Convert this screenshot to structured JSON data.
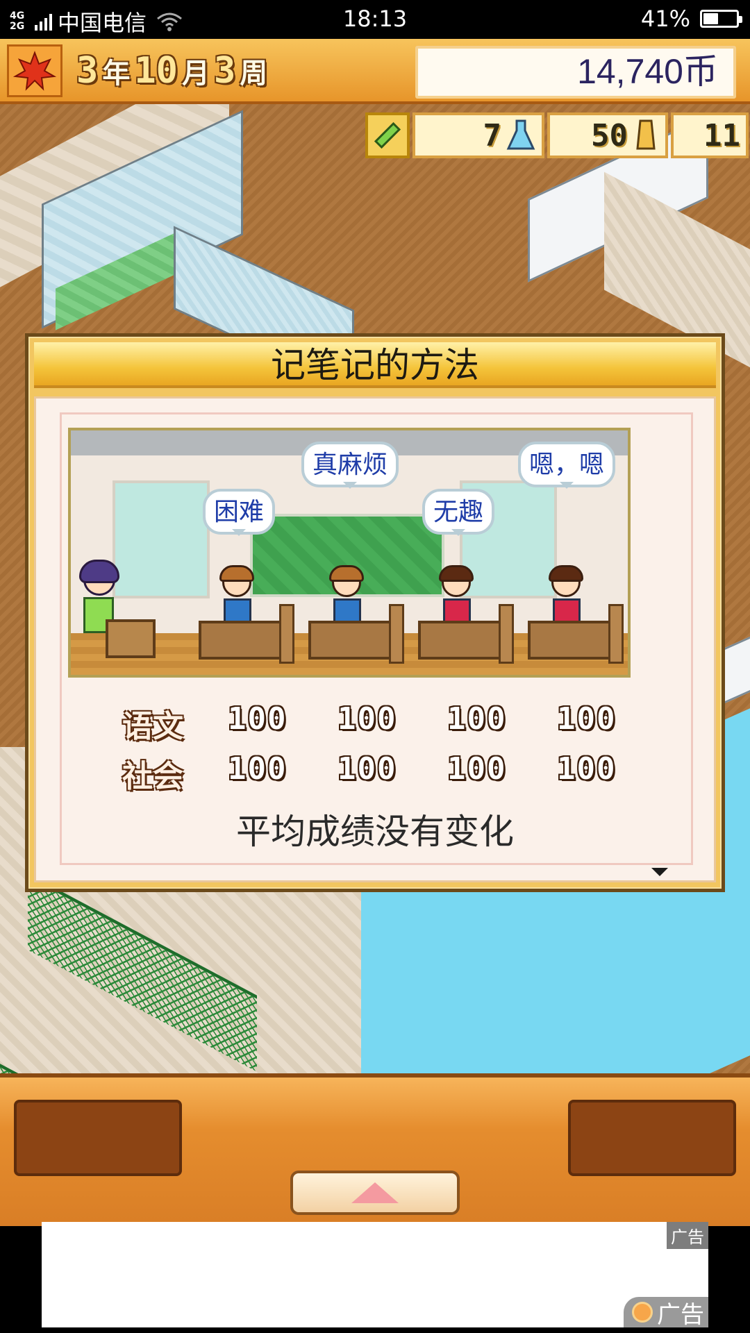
{
  "status_bar": {
    "network": "4G 2G",
    "carrier": "中国电信",
    "time": "18:13",
    "battery_percent": "41%",
    "battery_level": 0.41
  },
  "hud": {
    "date": {
      "year": "3",
      "year_unit": "年",
      "month": "10",
      "month_unit": "月",
      "week": "3",
      "week_unit": "周"
    },
    "money": "14,740币",
    "stats": [
      {
        "icon": "pencil-icon",
        "value": ""
      },
      {
        "icon": "flask-icon",
        "value": "7"
      },
      {
        "icon": "trophy-icon",
        "value": "50"
      },
      {
        "icon": "",
        "value": "11"
      }
    ]
  },
  "dialog": {
    "title": "记笔记的方法",
    "bubbles": [
      "困难",
      "真麻烦",
      "无趣",
      "嗯，嗯"
    ],
    "scores": [
      {
        "subject": "语文",
        "values": [
          "100",
          "100",
          "100",
          "100"
        ]
      },
      {
        "subject": "社会",
        "values": [
          "100",
          "100",
          "100",
          "100"
        ]
      }
    ],
    "message": "平均成绩没有变化"
  },
  "ad": {
    "tag": "广告",
    "corner_label": "广告"
  },
  "colors": {
    "hud_orange": "#e7952a",
    "money_text": "#2b2460",
    "bubble_text": "#1f3da8",
    "water": "#78d8f2"
  }
}
